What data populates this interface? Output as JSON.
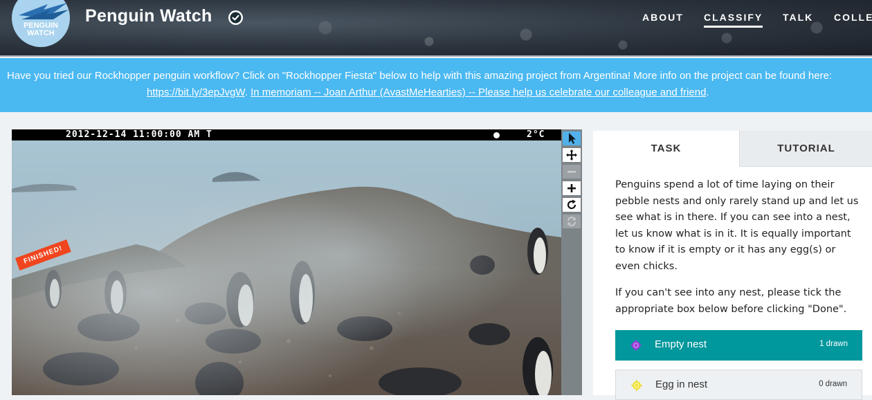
{
  "header": {
    "logo_lines": [
      "PENGUIN",
      "WATCH"
    ],
    "project_title": "Penguin Watch",
    "nav": [
      {
        "label": "ABOUT",
        "active": false
      },
      {
        "label": "CLASSIFY",
        "active": true
      },
      {
        "label": "TALK",
        "active": false
      },
      {
        "label": "COLLECT",
        "active": false
      }
    ]
  },
  "announcement": {
    "text": "Have you tried our Rockhopper penguin workflow? Click on \"Rockhopper Fiesta\" below to help with this amazing project from Argentina! More info on the project can be found here:",
    "link1": "https://bit.ly/3epJvgW",
    "separator": ".",
    "link2": "In memoriam -- Joan Arthur (AvastMeHearties) -- Please help us celebrate our colleague and friend",
    "end": "."
  },
  "subject": {
    "timestamp": "2012-12-14 11:00:00 AM T",
    "temperature": "2°C",
    "finished_badge": "FINISHED!"
  },
  "toolbar": {
    "tools": [
      {
        "name": "annotate",
        "icon": "pointer-arrow-icon",
        "state": "active"
      },
      {
        "name": "move",
        "icon": "move-cross-icon",
        "state": "normal"
      },
      {
        "name": "zoom-out",
        "icon": "minus-icon",
        "state": "disabled"
      },
      {
        "name": "zoom-in",
        "icon": "plus-icon",
        "state": "normal"
      },
      {
        "name": "rotate",
        "icon": "rotate-icon",
        "state": "normal"
      },
      {
        "name": "reset",
        "icon": "reset-icon",
        "state": "disabled"
      }
    ]
  },
  "task_panel": {
    "tabs": [
      "TASK",
      "TUTORIAL"
    ],
    "instructions": [
      "Penguins spend a lot of time laying on their pebble nests and only rarely stand up and let us see what is in there. If you can see into a nest, let us know what is in it. It is equally important to know if it is empty or it has any egg(s) or even chicks.",
      "If you can't see into any nest, please tick the appropriate box below before clicking \"Done\"."
    ],
    "tools": [
      {
        "label": "Empty nest",
        "count": "1 drawn",
        "color": "#9b3cd6",
        "selected": true
      },
      {
        "label": "Egg in nest",
        "count": "0 drawn",
        "color": "#f0e23a",
        "selected": false
      }
    ]
  },
  "colors": {
    "announcement_bg": "#4ab8f1",
    "selected_tool_bg": "#00979d",
    "active_tool_bg": "#52b1ea",
    "finished_badge": "#f0451e"
  }
}
